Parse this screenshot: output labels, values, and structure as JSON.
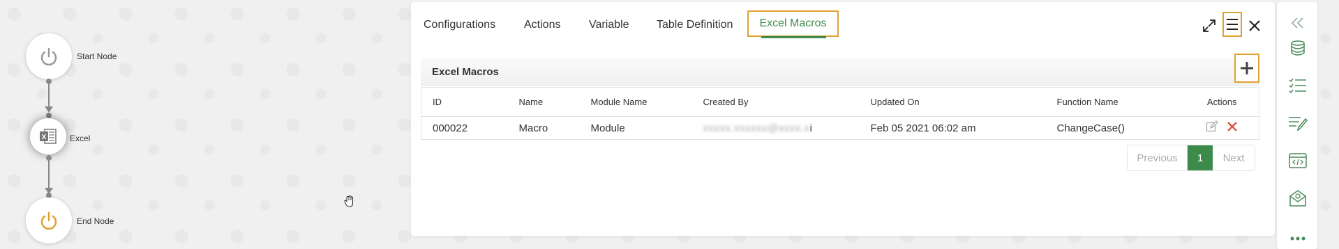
{
  "flow": {
    "start_label": "Start Node",
    "excel_label": "Excel",
    "end_label": "End Node"
  },
  "tabs": [
    {
      "label": "Configurations"
    },
    {
      "label": "Actions"
    },
    {
      "label": "Variable"
    },
    {
      "label": "Table Definition"
    },
    {
      "label": "Excel Macros",
      "active": true
    }
  ],
  "section": {
    "title": "Excel Macros"
  },
  "table": {
    "headers": [
      "ID",
      "Name",
      "Module Name",
      "Created By",
      "Updated On",
      "Function Name",
      "Actions"
    ],
    "rows": [
      {
        "id": "000022",
        "name": "Macro",
        "module": "Module",
        "created_by": "xxxxx.xxxxxx@xxxx.x",
        "created_by_tail": "i",
        "updated_on": "Feb 05 2021 06:02 am",
        "function": "ChangeCase()"
      }
    ]
  },
  "pagination": {
    "previous": "Previous",
    "current": "1",
    "next": "Next"
  },
  "colors": {
    "accent_green": "#3d8b4a",
    "highlight_orange": "#e0a132",
    "delete_red": "#e0533d"
  },
  "icons": {
    "header": [
      "expand-icon",
      "menu-icon",
      "close-icon"
    ],
    "right_bar": [
      "collapse-icon",
      "database-icon",
      "checklist-icon",
      "edit-list-icon",
      "code-window-icon",
      "email-icon",
      "more-icon"
    ]
  }
}
